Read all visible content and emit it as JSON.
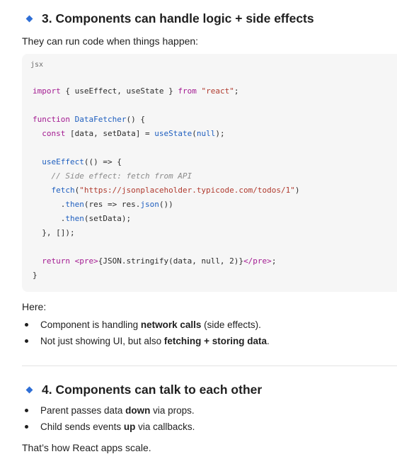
{
  "section3": {
    "heading": "3. Components can handle logic + side effects",
    "intro": "They can run code when things happen:",
    "code_lang": "jsx",
    "code": {
      "l1": {
        "a": "import",
        "b": " { useEffect, useState } ",
        "c": "from",
        "d": " ",
        "e": "\"react\"",
        "f": ";"
      },
      "l3": {
        "a": "function",
        "b": " ",
        "c": "DataFetcher",
        "d": "() {"
      },
      "l4": {
        "a": "  ",
        "b": "const",
        "c": " [data, setData] = ",
        "d": "useState",
        "e": "(",
        "f": "null",
        "g": ");"
      },
      "l6": {
        "a": "  ",
        "b": "useEffect",
        "c": "(() => {"
      },
      "l7": {
        "a": "    ",
        "b": "// Side effect: fetch from API"
      },
      "l8": {
        "a": "    ",
        "b": "fetch",
        "c": "(",
        "d": "\"https://jsonplaceholder.typicode.com/todos/1\"",
        "e": ")"
      },
      "l9": {
        "a": "      .",
        "b": "then",
        "c": "(res => res.",
        "d": "json",
        "e": "())"
      },
      "l10": {
        "a": "      .",
        "b": "then",
        "c": "(setData);"
      },
      "l11": {
        "a": "  }, []);"
      },
      "l13": {
        "a": "  ",
        "b": "return",
        "c": " ",
        "d": "<pre>",
        "e": "{JSON.stringify(data, null, 2)}",
        "f": "</pre>",
        "g": ";"
      },
      "l14": {
        "a": "}"
      }
    },
    "here_label": "Here:",
    "bullets": [
      {
        "pre": "Component is handling ",
        "bold": "network calls",
        "post": " (side effects)."
      },
      {
        "pre": "Not just showing UI, but also ",
        "bold": "fetching + storing data",
        "post": "."
      }
    ]
  },
  "section4": {
    "heading": "4. Components can talk to each other",
    "bullets": [
      {
        "pre": "Parent passes data ",
        "bold": "down",
        "post": " via props."
      },
      {
        "pre": "Child sends events ",
        "bold": "up",
        "post": " via callbacks."
      }
    ],
    "closing": "That’s how React apps scale."
  }
}
